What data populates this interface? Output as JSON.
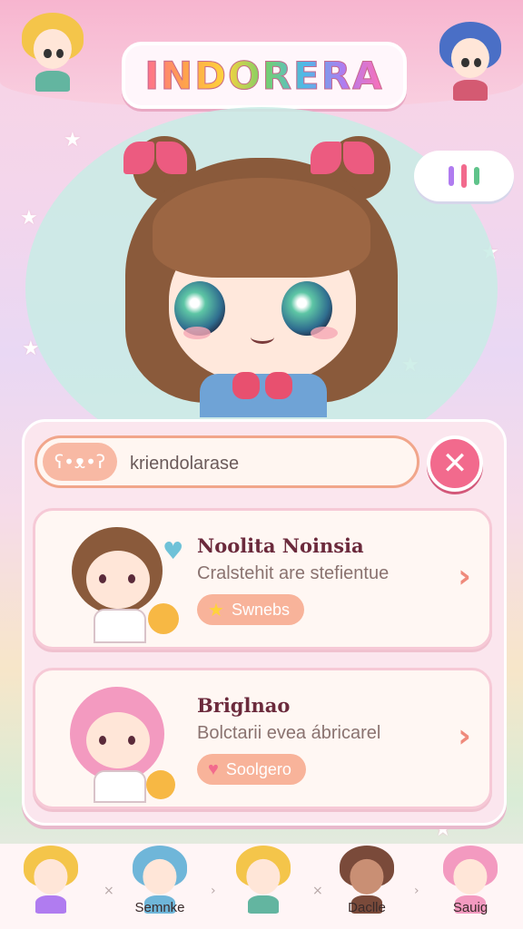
{
  "header": {
    "title": "INDORERA"
  },
  "hero": {
    "cloud_icon": "exclamation-cloud"
  },
  "search": {
    "icons": [
      "bear-icon",
      "bell-icon"
    ],
    "value": "kriendolarase",
    "close_label": "✕"
  },
  "cards": [
    {
      "name": "Noolita Noinsia",
      "description": "Cralstehit are stefientue",
      "tag_icon": "star-icon",
      "tag_label": "Swnebs"
    },
    {
      "name": "Briglnao",
      "description": "Bolctarii evea ábricarel",
      "tag_icon": "heart-icon",
      "tag_label": "Soolgero"
    }
  ],
  "bottom_nav": {
    "items": [
      {
        "label": ""
      },
      {
        "label": "Semnke"
      },
      {
        "label": ""
      },
      {
        "label": "Daclle"
      },
      {
        "label": "Sauig"
      }
    ]
  },
  "colors": {
    "accent_pink": "#f26a8d",
    "tag_peach": "#f8b39a",
    "card_bg": "#fff7f3",
    "panel_bg": "#fbe6ee"
  }
}
